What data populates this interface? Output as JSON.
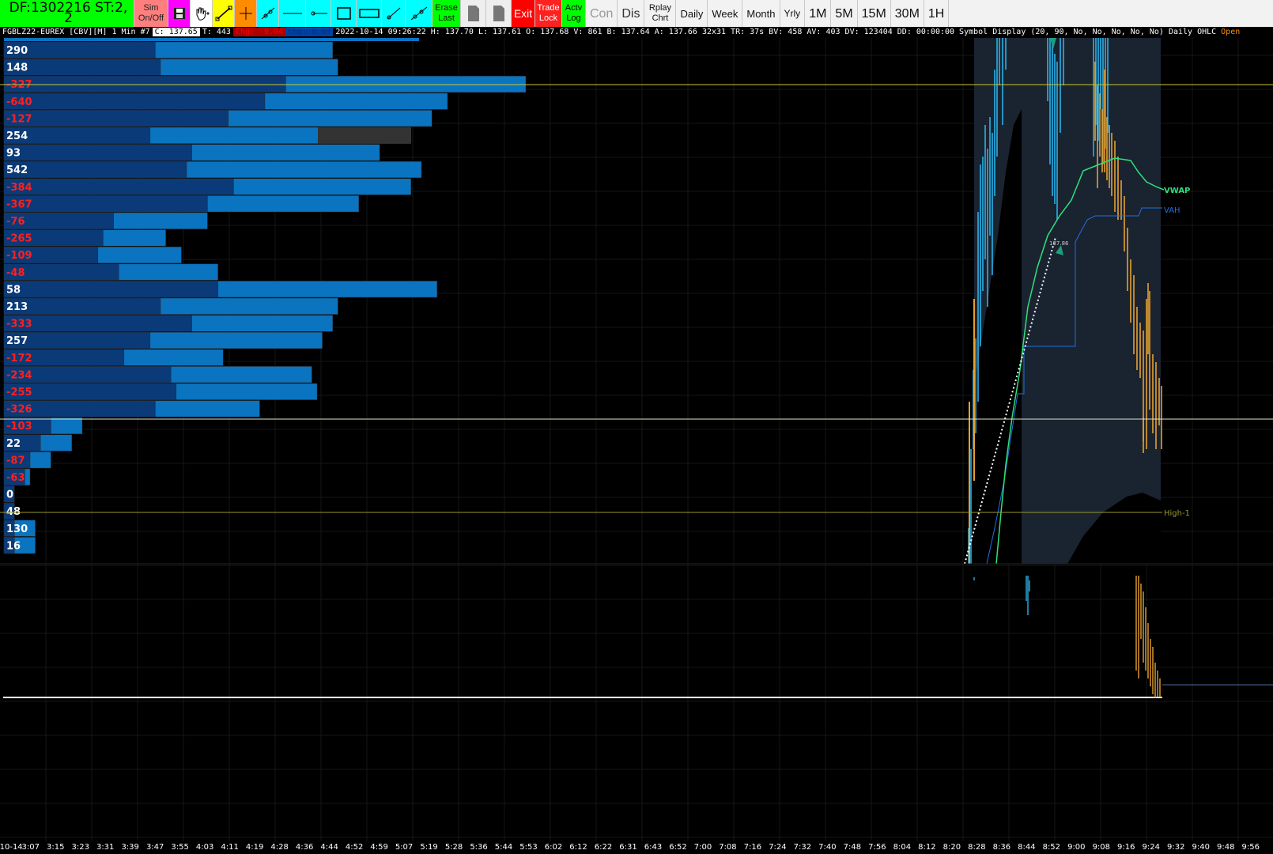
{
  "toolbar": {
    "dataframe_id": "DF:1302216  ST:2, 2",
    "sim_label": "Sim On/Off",
    "erase_last": "Erase Last",
    "exit": "Exit",
    "trade_lock": "Trade Lock",
    "actv_log": "Actv Log",
    "con": "Con",
    "dis": "Dis",
    "replay": "Rplay Chrt",
    "periods": [
      "Daily",
      "Week",
      "Month",
      "Yrly"
    ],
    "intervals": [
      "1M",
      "5M",
      "15M",
      "30M",
      "1H"
    ],
    "icons": [
      "save-icon",
      "hand-pan-icon",
      "draw-line-icon",
      "crosshair-icon",
      "ray-icon",
      "horizontal-line-icon",
      "horizontal-ray-icon",
      "rectangle-icon",
      "rectangle-ext-icon",
      "trendline-icon",
      "extended-line-icon"
    ]
  },
  "infobar": {
    "symbol": "FGBLZ22-EUREX [CBV][M]  1 Min   #7",
    "close": "C: 137.65",
    "ticks": "T: 443",
    "chg": "Chg: -0.04",
    "chgpct": "Chg: 0.03",
    "details": "2022-10-14 09:26:22 H: 137.70 L: 137.61 O: 137.68 V: 861 B: 137.64 A: 137.66 32x31 TR: 37s BV: 458 AV: 403 DV: 123404 DD: 00:00:00 Symbol Display  (20, 90, No, No, No, No, No)  Daily OHLC",
    "open_label": "Open"
  },
  "colors": {
    "bg": "#000000",
    "dark_bar": "#0b3a78",
    "light_bar": "#0a74c0",
    "positive_text": "#ffffff",
    "negative_text": "#ff2020",
    "vwap": "#2ee07a",
    "vah": "#2070e0",
    "high1": "#9a9a30",
    "up_candle": "#2ab0e8",
    "down_candle": "#e6a030"
  },
  "chart_data": {
    "type": "bar",
    "title": "",
    "profile_delta": [
      290,
      148,
      -327,
      -640,
      -127,
      254,
      93,
      542,
      -384,
      -367,
      -76,
      -265,
      -109,
      -48,
      58,
      213,
      -333,
      257,
      -172,
      -234,
      -255,
      -326,
      -103,
      22,
      -87,
      -63,
      0,
      48,
      130,
      16
    ],
    "profile_dark_len": [
      0.29,
      0.3,
      0.54,
      0.5,
      0.43,
      0.28,
      0.36,
      0.35,
      0.44,
      0.39,
      0.21,
      0.19,
      0.18,
      0.22,
      0.41,
      0.3,
      0.36,
      0.28,
      0.23,
      0.32,
      0.33,
      0.29,
      0.09,
      0.07,
      0.05,
      0.04,
      0.02,
      0.02,
      0.02,
      0.02
    ],
    "profile_total_len": [
      0.63,
      0.64,
      1.0,
      0.85,
      0.82,
      0.78,
      0.72,
      0.8,
      0.78,
      0.68,
      0.39,
      0.31,
      0.34,
      0.41,
      0.83,
      0.64,
      0.63,
      0.61,
      0.42,
      0.59,
      0.6,
      0.49,
      0.15,
      0.13,
      0.09,
      0.05,
      0.02,
      0.02,
      0.06,
      0.06
    ],
    "time_labels": [
      "-10-14",
      "3:07",
      "3:15",
      "3:23",
      "3:31",
      "3:39",
      "3:47",
      "3:55",
      "4:03",
      "4:11",
      "4:19",
      "4:28",
      "4:36",
      "4:44",
      "4:52",
      "4:59",
      "5:07",
      "5:19",
      "5:28",
      "5:36",
      "5:44",
      "5:53",
      "6:02",
      "6:12",
      "6:22",
      "6:31",
      "6:43",
      "6:52",
      "7:00",
      "7:08",
      "7:16",
      "7:24",
      "7:32",
      "7:40",
      "7:48",
      "7:56",
      "8:04",
      "8:12",
      "8:20",
      "8:28",
      "8:36",
      "8:44",
      "8:52",
      "9:00",
      "9:08",
      "9:16",
      "9:24",
      "9:32",
      "9:40",
      "9:48",
      "9:56"
    ],
    "labels": {
      "vwap": "VWAP",
      "vah": "VAH",
      "high1": "High-1",
      "price_note": "137.86"
    }
  }
}
